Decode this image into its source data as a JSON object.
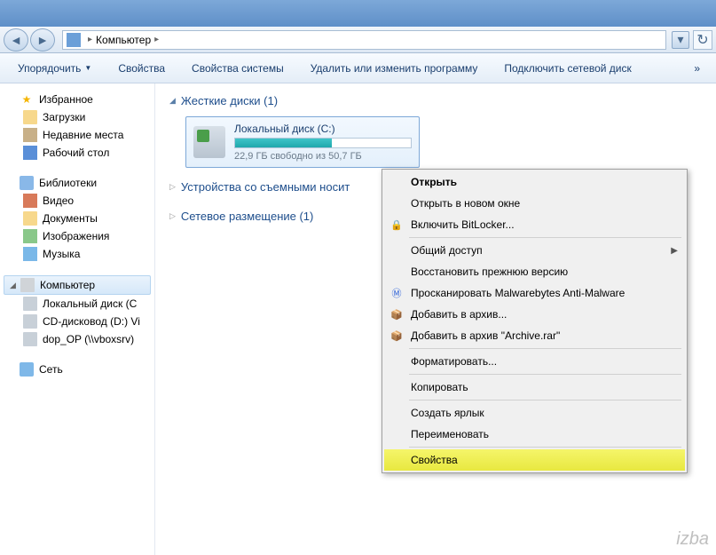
{
  "breadcrumb": {
    "location": "Компьютер"
  },
  "toolbar": {
    "organize": "Упорядочить",
    "properties": "Свойства",
    "sys_properties": "Свойства системы",
    "uninstall": "Удалить или изменить программу",
    "map_drive": "Подключить сетевой диск",
    "overflow": "»"
  },
  "sidebar": {
    "favorites": {
      "label": "Избранное",
      "downloads": "Загрузки",
      "recent": "Недавние места",
      "desktop": "Рабочий стол"
    },
    "libraries": {
      "label": "Библиотеки",
      "video": "Видео",
      "documents": "Документы",
      "pictures": "Изображения",
      "music": "Музыка"
    },
    "computer": {
      "label": "Компьютер",
      "local_c": "Локальный диск (C",
      "cd_d": "CD-дисковод (D:) Vi",
      "dop_op": "dop_OP (\\\\vboxsrv)"
    },
    "network": {
      "label": "Сеть"
    }
  },
  "sections": {
    "hdd": "Жесткие диски (1)",
    "removable": "Устройства со съемными носит",
    "network": "Сетевое размещение (1)"
  },
  "drive": {
    "name": "Локальный диск (C:)",
    "free": "22,9 ГБ свободно из 50,7 ГБ"
  },
  "context_menu": {
    "open": "Открыть",
    "open_new": "Открыть в новом окне",
    "bitlocker": "Включить BitLocker...",
    "share": "Общий доступ",
    "restore": "Восстановить прежнюю версию",
    "malwarebytes": "Просканировать Malwarebytes Anti-Malware",
    "archive": "Добавить в архив...",
    "archive_rar": "Добавить в архив \"Archive.rar\"",
    "format": "Форматировать...",
    "copy": "Копировать",
    "shortcut": "Создать ярлык",
    "rename": "Переименовать",
    "properties": "Свойства"
  },
  "watermark": "izba"
}
